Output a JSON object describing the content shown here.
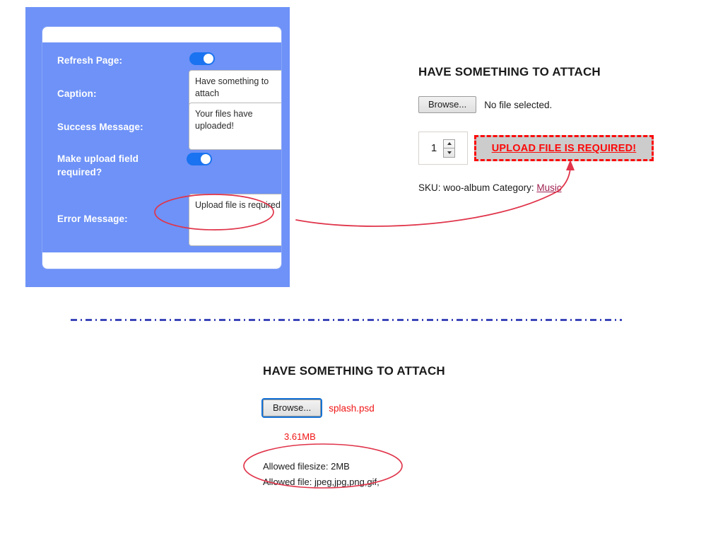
{
  "settings_panel": {
    "rows": [
      {
        "label": "Refresh Page:",
        "control": "toggle",
        "value": "on"
      },
      {
        "label": "Caption:",
        "control": "textarea",
        "value": "Have something to attach"
      },
      {
        "label": "Success Message:",
        "control": "textarea",
        "value": "Your files have uploaded!"
      },
      {
        "label": "Make upload field required?",
        "control": "toggle",
        "value": "on"
      },
      {
        "label": "Error Message:",
        "control": "textarea",
        "value": "Upload file is required!"
      }
    ],
    "panel_color": "#6e92f7",
    "toggle_on_color": "#1a73f0"
  },
  "product_section": {
    "title": "HAVE SOMETHING TO ATTACH",
    "browse_label": "Browse...",
    "file_status": "No file selected.",
    "quantity": "1",
    "upload_error": "UPLOAD FILE IS REQUIRED!",
    "error_color": "#fb0a0a",
    "meta_prefix": "SKU: woo-album Category:",
    "meta_category": "Music"
  },
  "upload_section": {
    "title": "HAVE SOMETHING TO ATTACH",
    "browse_label": "Browse...",
    "selected_file": "splash.psd",
    "file_size": "3.61MB",
    "allowed_filesize": "Allowed filesize: 2MB",
    "allowed_file_types": "Allowed file: jpeg,jpg,png,gif,",
    "accent_color": "#f01616"
  },
  "divider": {
    "color": "#3b46b8",
    "style": "dash-dot"
  }
}
